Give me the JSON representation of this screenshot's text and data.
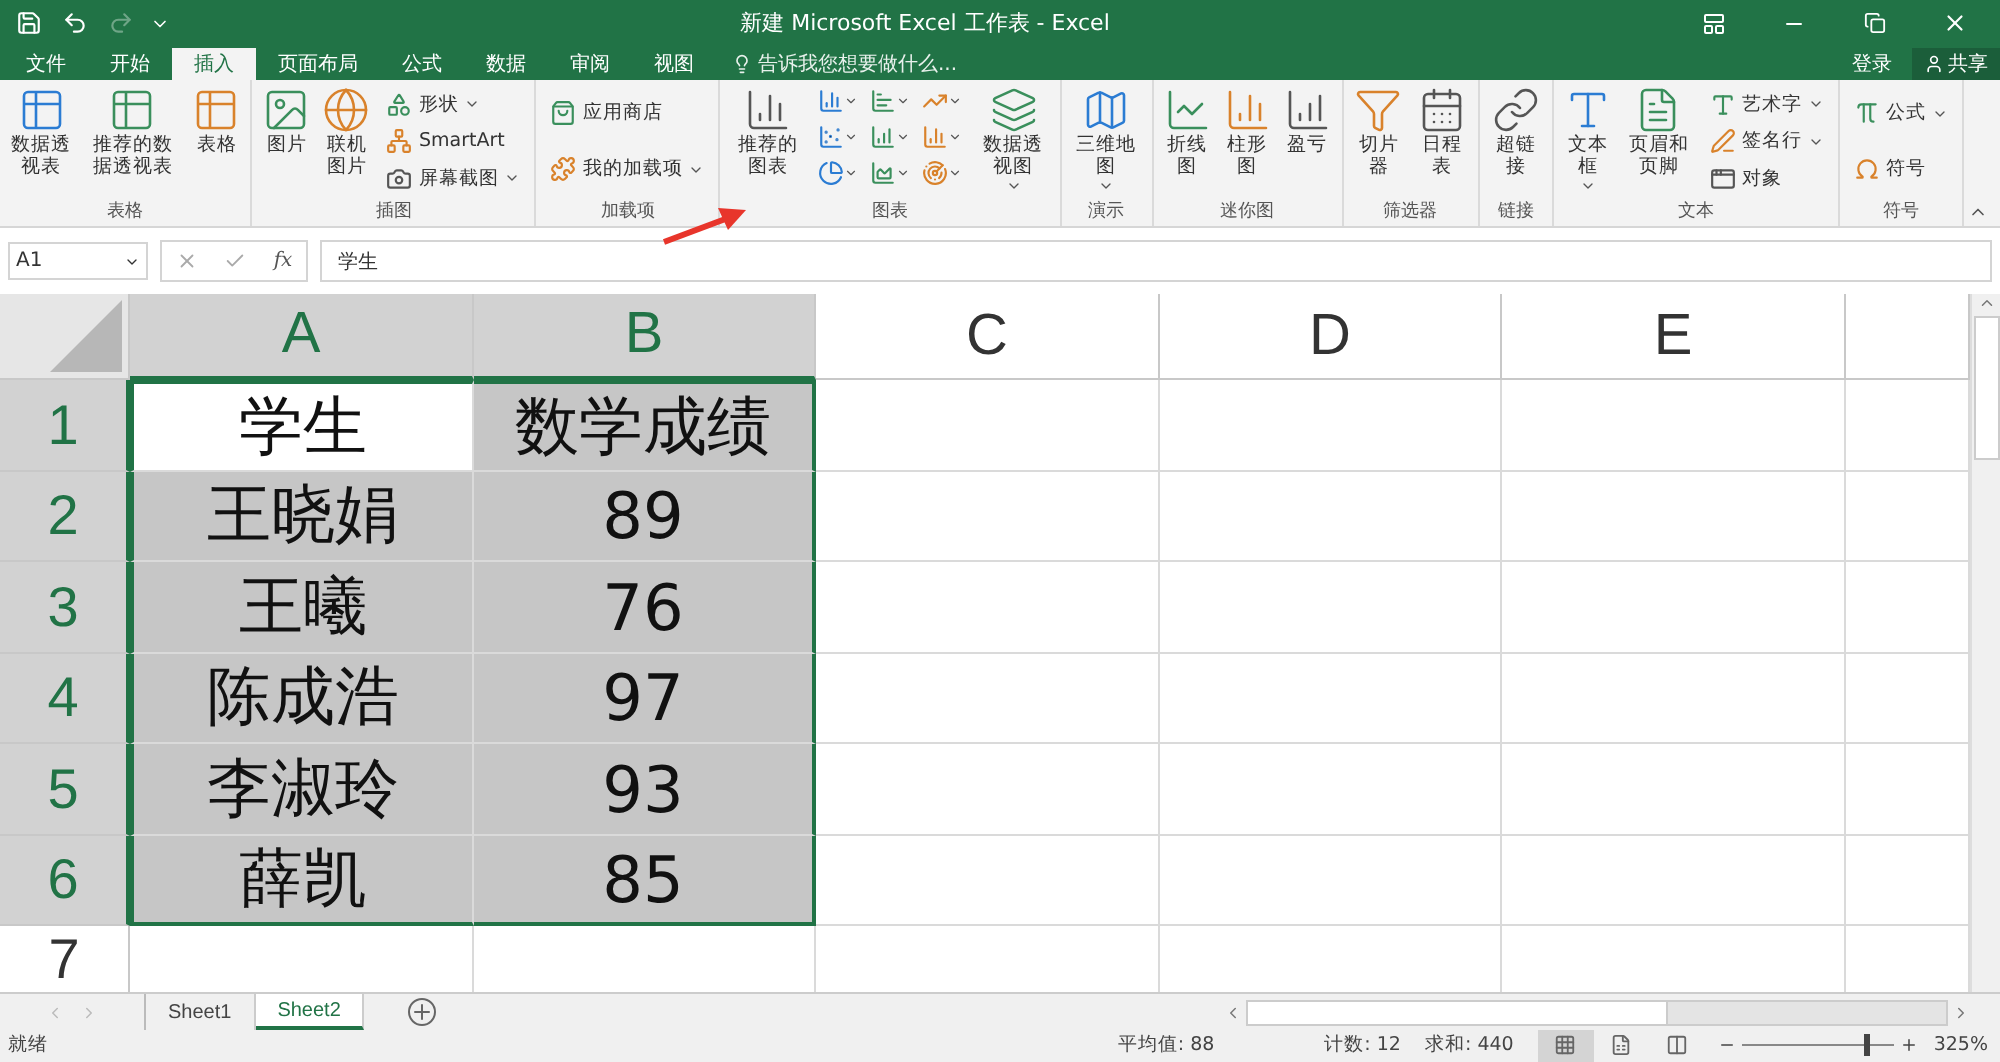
{
  "title_bar": {
    "quick_access": [
      {
        "kind": "save",
        "disabled": false
      },
      {
        "kind": "undo",
        "disabled": false
      },
      {
        "kind": "redo",
        "disabled": true
      }
    ],
    "title": "新建 Microsoft Excel 工作表 - Excel"
  },
  "tabs": [
    {
      "label": "文件",
      "selected": false
    },
    {
      "label": "开始",
      "selected": false
    },
    {
      "label": "插入",
      "selected": true
    },
    {
      "label": "页面布局",
      "selected": false
    },
    {
      "label": "公式",
      "selected": false
    },
    {
      "label": "数据",
      "selected": false
    },
    {
      "label": "审阅",
      "selected": false
    },
    {
      "label": "视图",
      "selected": false
    }
  ],
  "tell_me": {
    "placeholder": "告诉我您想要做什么..."
  },
  "account": {
    "sign_in": "登录",
    "share": "共享"
  },
  "ribbon_groups": [
    {
      "label": "表格",
      "items": [
        {
          "kind": "large",
          "label": "数据透视表",
          "dropdown": false
        },
        {
          "kind": "large",
          "label": "推荐的数据透视表",
          "dropdown": false
        },
        {
          "kind": "large",
          "label": "表格",
          "dropdown": false
        }
      ]
    },
    {
      "label": "插图",
      "items": [
        {
          "kind": "large",
          "label": "图片",
          "dropdown": false
        },
        {
          "kind": "large",
          "label": "联机图片",
          "dropdown": false
        },
        {
          "kind": "stack",
          "entries": [
            {
              "label": "形状",
              "dropdown": true
            },
            {
              "label": "SmartArt",
              "dropdown": false
            },
            {
              "label": "屏幕截图",
              "dropdown": true
            }
          ]
        }
      ]
    },
    {
      "label": "加载项",
      "items": [
        {
          "kind": "stack",
          "entries": [
            {
              "label": "应用商店",
              "dropdown": false
            },
            {
              "label": "我的加载项",
              "dropdown": true
            }
          ]
        }
      ]
    },
    {
      "label": "图表",
      "items": [
        {
          "kind": "large",
          "label": "推荐的图表",
          "dropdown": false
        },
        {
          "kind": "gallery"
        },
        {
          "kind": "large",
          "label": "数据透视图",
          "dropdown": true
        }
      ]
    },
    {
      "label": "演示",
      "items": [
        {
          "kind": "large",
          "label": "三维地图",
          "dropdown": true
        }
      ]
    },
    {
      "label": "迷你图",
      "items": [
        {
          "kind": "large",
          "label": "折线图",
          "dropdown": false
        },
        {
          "kind": "large",
          "label": "柱形图",
          "dropdown": false
        },
        {
          "kind": "large",
          "label": "盈亏",
          "dropdown": false
        }
      ]
    },
    {
      "label": "筛选器",
      "items": [
        {
          "kind": "large",
          "label": "切片器",
          "dropdown": false
        },
        {
          "kind": "large",
          "label": "日程表",
          "dropdown": false
        }
      ]
    },
    {
      "label": "链接",
      "items": [
        {
          "kind": "large",
          "label": "超链接",
          "dropdown": false
        }
      ]
    },
    {
      "label": "文本",
      "items": [
        {
          "kind": "large",
          "label": "文本框",
          "dropdown": true
        },
        {
          "kind": "large",
          "label": "页眉和页脚",
          "dropdown": false
        },
        {
          "kind": "stack",
          "entries": [
            {
              "label": "艺术字",
              "dropdown": true
            },
            {
              "label": "签名行",
              "dropdown": true
            },
            {
              "label": "对象",
              "dropdown": false
            }
          ]
        }
      ]
    },
    {
      "label": "符号",
      "items": [
        {
          "kind": "stack",
          "entries": [
            {
              "label": "公式",
              "dropdown": true
            },
            {
              "label": "符号",
              "dropdown": false
            }
          ]
        }
      ]
    }
  ],
  "formula_bar": {
    "name_box": "A1",
    "function_label": "fx",
    "value": "学生"
  },
  "grid": {
    "columns": [
      {
        "label": "A",
        "selected": true
      },
      {
        "label": "B",
        "selected": true
      },
      {
        "label": "C",
        "selected": false
      },
      {
        "label": "D",
        "selected": false
      },
      {
        "label": "E",
        "selected": false
      }
    ],
    "rows": [
      {
        "header": "1",
        "selected": true,
        "cells": [
          {
            "text": "学生",
            "selected": true,
            "active": true
          },
          {
            "text": "数学成绩",
            "selected": true,
            "active": false
          }
        ]
      },
      {
        "header": "2",
        "selected": true,
        "cells": [
          {
            "text": "王晓娟",
            "selected": true,
            "active": false
          },
          {
            "text": "89",
            "selected": true,
            "active": false
          }
        ]
      },
      {
        "header": "3",
        "selected": true,
        "cells": [
          {
            "text": "王曦",
            "selected": true,
            "active": false
          },
          {
            "text": "76",
            "selected": true,
            "active": false
          }
        ]
      },
      {
        "header": "4",
        "selected": true,
        "cells": [
          {
            "text": "陈成浩",
            "selected": true,
            "active": false
          },
          {
            "text": "97",
            "selected": true,
            "active": false
          }
        ]
      },
      {
        "header": "5",
        "selected": true,
        "cells": [
          {
            "text": "李淑玲",
            "selected": true,
            "active": false
          },
          {
            "text": "93",
            "selected": true,
            "active": false
          }
        ]
      },
      {
        "header": "6",
        "selected": true,
        "cells": [
          {
            "text": "薛凯",
            "selected": true,
            "active": false
          },
          {
            "text": "85",
            "selected": true,
            "active": false
          }
        ]
      },
      {
        "header": "7",
        "selected": false
      }
    ]
  },
  "sheet_tabs": [
    {
      "label": "Sheet1",
      "selected": false
    },
    {
      "label": "Sheet2",
      "selected": true
    }
  ],
  "status_bar": {
    "status": "就绪",
    "average": "平均值: 88",
    "count": "计数: 12",
    "sum": "求和: 440",
    "views": [
      {
        "selected": true
      },
      {
        "selected": false
      },
      {
        "selected": false
      }
    ],
    "zoom": {
      "level": 0.83,
      "reading": "325%"
    }
  }
}
